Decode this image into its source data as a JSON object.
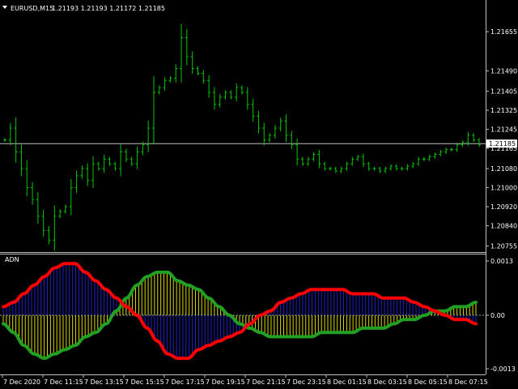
{
  "header": {
    "symbol": "EURUSD,M15",
    "ohlc": "1.21193 1.21193 1.21172 1.21185"
  },
  "indicator": {
    "name": "ADN"
  },
  "price_axis": {
    "labels": [
      "1.21655",
      "1.21490",
      "1.21405",
      "1.21325",
      "1.21245",
      "1.21165",
      "1.21080",
      "1.21000",
      "1.20920",
      "1.20840",
      "1.20755"
    ],
    "current_price": "1.21185"
  },
  "indicator_axis": {
    "labels": [
      "0.0013",
      "0.00",
      "-0.0013"
    ]
  },
  "time_axis": {
    "labels": [
      "7 Dec 2020",
      "7 Dec 11:15",
      "7 Dec 13:15",
      "7 Dec 15:15",
      "7 Dec 17:15",
      "7 Dec 19:15",
      "7 Dec 21:15",
      "7 Dec 23:15",
      "8 Dec 01:15",
      "8 Dec 03:15",
      "8 Dec 05:15",
      "8 Dec 07:15"
    ]
  },
  "colors": {
    "background": "#000000",
    "bars": "#00c800",
    "current_price_line": "#c0c0c0",
    "red_line": "#ff0000",
    "green_line": "#22a022",
    "blue_hist": "#2020c8",
    "yellow_hist": "#d8d800"
  },
  "chart_data": [
    {
      "type": "line",
      "title": "EURUSD,M15",
      "ylim": [
        1.2075,
        1.2172
      ],
      "current_price": 1.21185,
      "series": [
        {
          "values": [
            1.212,
            1.2125,
            1.2115,
            1.2108,
            1.21,
            1.2095,
            1.2088,
            1.2082,
            1.2078,
            1.2088,
            1.209,
            1.2092,
            1.21,
            1.2105,
            1.2108,
            1.2103,
            1.211,
            1.2108,
            1.2112,
            1.211,
            1.2108,
            1.2115,
            1.2112,
            1.211,
            1.2115,
            1.2118,
            1.2125,
            1.214,
            1.2142,
            1.2145,
            1.2146,
            1.215,
            1.2163,
            1.2155,
            1.215,
            1.2148,
            1.2145,
            1.214,
            1.2135,
            1.2138,
            1.214,
            1.2138,
            1.2142,
            1.214,
            1.2135,
            1.213,
            1.2125,
            1.212,
            1.2122,
            1.2125,
            1.2128,
            1.2122,
            1.2118,
            1.2112,
            1.211,
            1.2112,
            1.2114,
            1.211,
            1.2108,
            1.2108,
            1.2107,
            1.2108,
            1.211,
            1.2112,
            1.2113,
            1.211,
            1.2108,
            1.2108,
            1.2107,
            1.2108,
            1.2109,
            1.2108,
            1.2108,
            1.2109,
            1.211,
            1.2112,
            1.2112,
            1.2113,
            1.2114,
            1.2115,
            1.2116,
            1.2116,
            1.2118,
            1.2119,
            1.2122,
            1.212,
            1.2118
          ]
        }
      ]
    },
    {
      "type": "line",
      "title": "ADN",
      "ylim": [
        -0.0013,
        0.0013
      ],
      "series": [
        {
          "color": "red",
          "values": [
            0.0002,
            0.0003,
            0.0005,
            0.0007,
            0.0009,
            0.0011,
            0.0012,
            0.0012,
            0.001,
            0.0008,
            0.0006,
            0.0004,
            0.0002,
            0.0,
            -0.0003,
            -0.0006,
            -0.0009,
            -0.001,
            -0.001,
            -0.0008,
            -0.0007,
            -0.0006,
            -0.0005,
            -0.0004,
            -0.0002,
            0.0,
            0.0001,
            0.0003,
            0.0004,
            0.0005,
            0.0006,
            0.0006,
            0.0006,
            0.0006,
            0.0005,
            0.0005,
            0.0005,
            0.0004,
            0.0004,
            0.0004,
            0.0003,
            0.0002,
            0.0001,
            0.0,
            -0.0001,
            -0.0001,
            -0.0002
          ]
        },
        {
          "color": "green",
          "values": [
            -0.0002,
            -0.0004,
            -0.0007,
            -0.0009,
            -0.001,
            -0.0009,
            -0.0008,
            -0.0007,
            -0.0005,
            -0.0004,
            -0.0002,
            0.0001,
            0.0004,
            0.0007,
            0.0009,
            0.001,
            0.001,
            0.0008,
            0.0007,
            0.0006,
            0.0004,
            0.0002,
            0.0,
            -0.0002,
            -0.0003,
            -0.0004,
            -0.0005,
            -0.0005,
            -0.0005,
            -0.0005,
            -0.0005,
            -0.0004,
            -0.0004,
            -0.0004,
            -0.0004,
            -0.0003,
            -0.0003,
            -0.0003,
            -0.0002,
            -0.0001,
            -0.0001,
            0.0,
            0.0001,
            0.0001,
            0.0002,
            0.0002,
            0.0003
          ]
        }
      ]
    }
  ]
}
